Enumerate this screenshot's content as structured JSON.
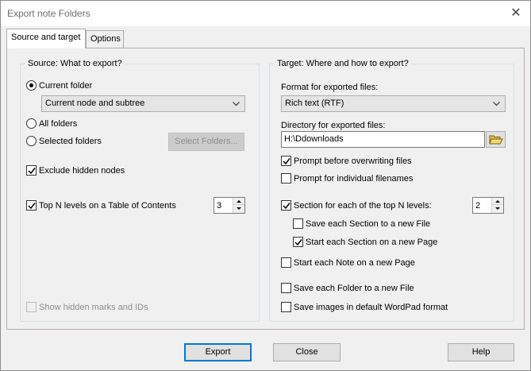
{
  "window": {
    "title": "Export note Folders",
    "close_symbol": "✕"
  },
  "tabs": [
    {
      "label": "Source and target",
      "active": true
    },
    {
      "label": "Options",
      "active": false
    }
  ],
  "source": {
    "group_title": "Source: What to export?",
    "current_folder": {
      "label": "Current folder",
      "checked": true
    },
    "subtree_combo": {
      "value": "Current node and subtree"
    },
    "all_folders": {
      "label": "All folders",
      "checked": false
    },
    "selected_folders": {
      "label": "Selected folders",
      "checked": false
    },
    "select_folders_button": "Select Folders...",
    "exclude_hidden": {
      "label": "Exclude hidden nodes",
      "checked": true
    },
    "top_n_toc": {
      "label": "Top N levels on a Table of Contents",
      "checked": true,
      "value": "3"
    },
    "show_hidden_marks": {
      "label": "Show hidden marks and IDs",
      "checked": false,
      "enabled": false
    }
  },
  "target": {
    "group_title": "Target: Where and how to export?",
    "format_label": "Format for exported files:",
    "format_value": "Rich text (RTF)",
    "directory_label": "Directory for exported files:",
    "directory_value": "H:\\Ddownloads",
    "prompt_overwrite": {
      "label": "Prompt before overwriting files",
      "checked": true
    },
    "prompt_filenames": {
      "label": "Prompt for individual filenames",
      "checked": false
    },
    "section_top_n": {
      "label": "Section for each of the top N levels:",
      "checked": true,
      "value": "2"
    },
    "save_section_file": {
      "label": "Save each Section to a new File",
      "checked": false
    },
    "start_section_page": {
      "label": "Start each Section on a new Page",
      "checked": true
    },
    "start_note_page": {
      "label": "Start each Note on a new Page",
      "checked": false
    },
    "save_folder_file": {
      "label": "Save each Folder to a new File",
      "checked": false
    },
    "save_images_wordpad": {
      "label": "Save images in default WordPad format",
      "checked": false
    }
  },
  "buttons": {
    "export": "Export",
    "close": "Close",
    "help": "Help"
  },
  "icons": {
    "folder": "folder-open-icon",
    "chevron": "chevron-down-icon",
    "check": "checkmark-icon"
  },
  "colors": {
    "default_button_border": "#0078d7",
    "dialog_bg": "#f0f0f0"
  }
}
